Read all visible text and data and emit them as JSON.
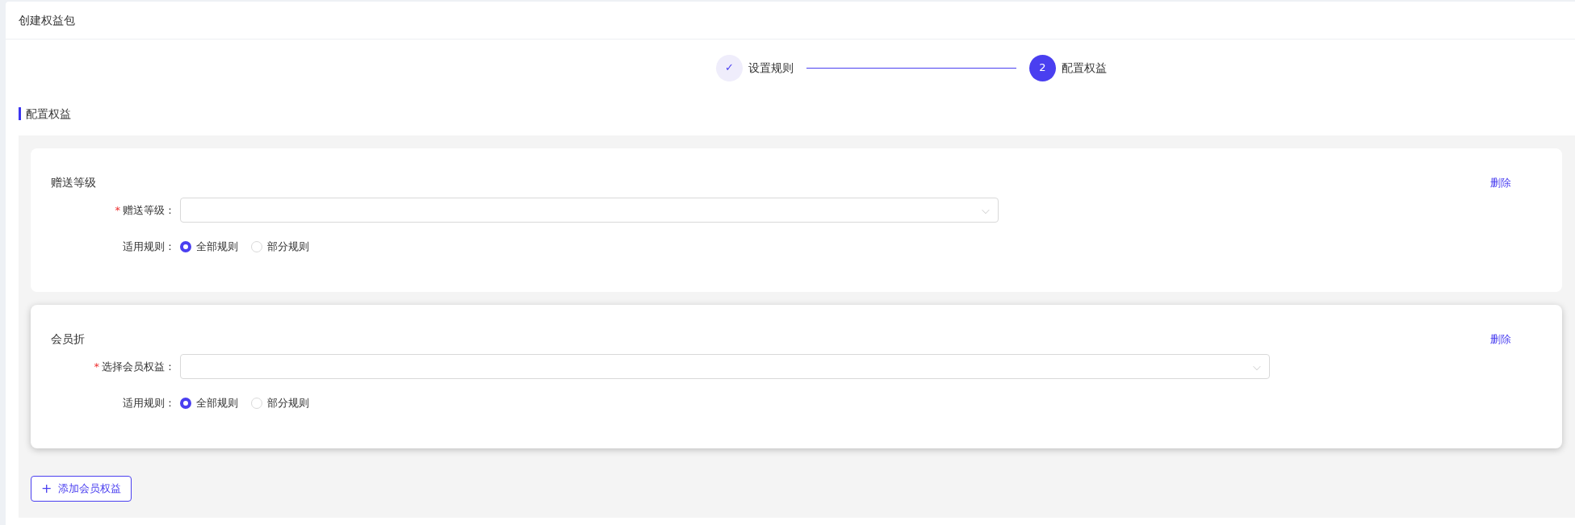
{
  "page_title": "创建权益包",
  "steps": [
    {
      "label": "设置规则",
      "indicator": "✓",
      "kind": "done"
    },
    {
      "label": "配置权益",
      "indicator": "2",
      "kind": "current"
    }
  ],
  "section_title": "配置权益",
  "cards": [
    {
      "title": "赠送等级",
      "delete": "删除",
      "hovered": false,
      "select": {
        "label": "赠送等级：",
        "required_mark": "*",
        "arrow": "⌵"
      },
      "rule": {
        "label": "适用规则：",
        "options": [
          {
            "label": "全部规则",
            "selected": true
          },
          {
            "label": "部分规则",
            "selected": false
          }
        ]
      }
    },
    {
      "title": "会员折",
      "delete": "删除",
      "hovered": true,
      "select": {
        "label": "选择会员权益：",
        "required_mark": "*",
        "arrow": "⌵"
      },
      "rule": {
        "label": "适用规则：",
        "options": [
          {
            "label": "全部规则",
            "selected": true
          },
          {
            "label": "部分规则",
            "selected": false
          }
        ]
      }
    }
  ],
  "add_button": {
    "icon": "+",
    "label": "添加会员权益"
  }
}
